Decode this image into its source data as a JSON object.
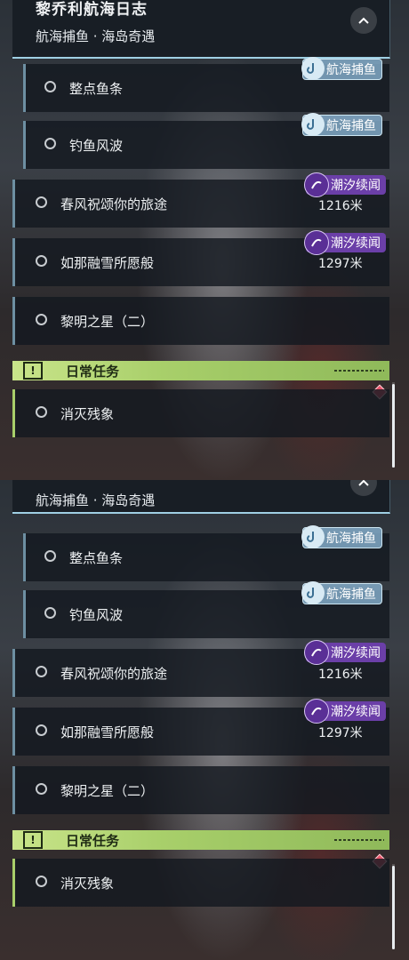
{
  "header": {
    "title": "黎乔利航海日志",
    "subtitle": "航海捕鱼 · 海岛奇遇"
  },
  "quests": [
    {
      "title": "整点鱼条",
      "tag": "航海捕鱼",
      "tag_type": "fishing",
      "distance": ""
    },
    {
      "title": "钓鱼风波",
      "tag": "航海捕鱼",
      "tag_type": "fishing",
      "distance": ""
    },
    {
      "title": "春风祝颂你的旅途",
      "tag": "潮汐续闻",
      "tag_type": "tide",
      "distance": "1216米"
    },
    {
      "title": "如那融雪所愿般",
      "tag": "潮汐续闻",
      "tag_type": "tide",
      "distance": "1297米"
    },
    {
      "title": "黎明之星（二）",
      "tag": "",
      "tag_type": "",
      "distance": ""
    }
  ],
  "daily": {
    "icon": "!",
    "label": "日常任务",
    "items": [
      {
        "title": "消灭残象"
      }
    ]
  },
  "icons": {
    "collapse": "chevron-up-icon",
    "fishing_tag": "fishing-hook-icon",
    "tide_tag": "tide-swirl-icon",
    "daily": "exclamation-box-icon",
    "alert": "red-diamond-icon",
    "radio": "radio-circle-icon"
  },
  "colors": {
    "header_accent": "#9fd0e4",
    "quest_bar": "#6d8fa2",
    "fishing_tag": "#82aac8",
    "tide_tag": "#6b3fa8",
    "daily_bar": "#a8cf6a",
    "alert": "#e8546a"
  }
}
